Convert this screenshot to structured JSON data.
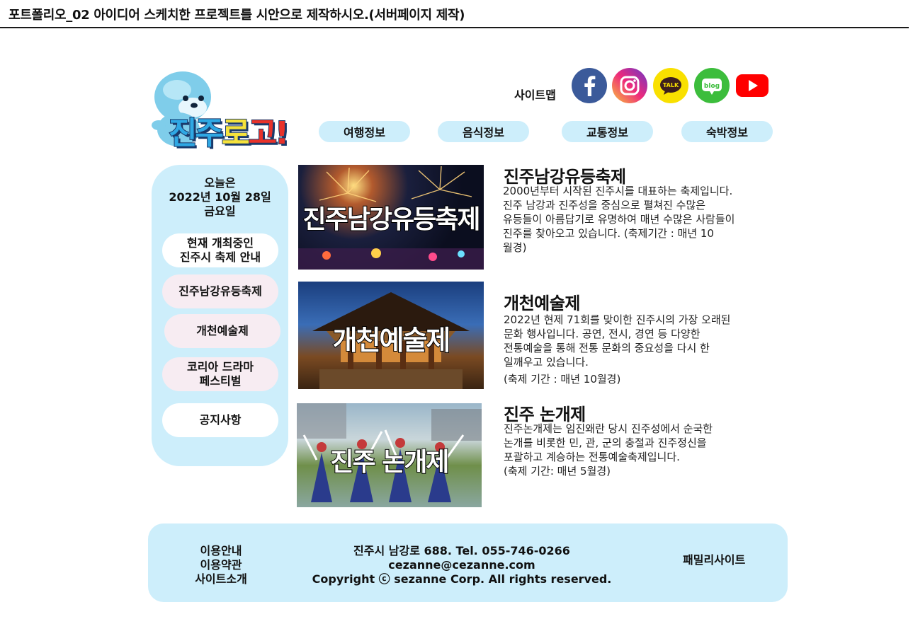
{
  "header": {
    "title": "포트폴리오_02 아이디어 스케치한 프로젝트를 시안으로 제작하시오.(서버페이지 제작)"
  },
  "logo": {
    "char1": "진",
    "char2": "주",
    "char3": "로",
    "char4": "고",
    "char5": "!"
  },
  "utility": {
    "sitemap": "사이트맵",
    "kakao_label": "TALK",
    "blog_label": "blog"
  },
  "nav": [
    "여행정보",
    "음식정보",
    "교통정보",
    "숙박정보"
  ],
  "sidebar": {
    "date_line1": "오늘은",
    "date_line2": "2022년 10월 28일",
    "date_line3": "금요일",
    "items": [
      {
        "line1": "현재 개최중인",
        "line2": "진주시 축제 안내"
      },
      {
        "line1": "진주남강유등축제",
        "line2": ""
      },
      {
        "line1": "개천예술제",
        "line2": ""
      },
      {
        "line1": "코리아 드라마",
        "line2": "페스티벌"
      },
      {
        "line1": "공지사항",
        "line2": ""
      }
    ]
  },
  "festivals": [
    {
      "image_caption": "진주남강유등축제",
      "title": "진주남강유등축제",
      "desc": "2000년부터 시작된 진주시를 대표하는 축제입니다.\n진주 남강과 진주성을 중심으로 펼쳐진 수많은\n유등들이 아름답기로 유명하여 매년 수많은 사람들이\n진주를 찾아오고 있습니다. (축제기간 : 매년 10\n월경)"
    },
    {
      "image_caption": "개천예술제",
      "title": "개천예술제",
      "desc": "2022년 현제 71회를 맞이한 진주시의 가장 오래된\n문화 행사입니다. 공연, 전시, 경연 등 다양한\n전통예술을 통해 전통 문화의 중요성을 다시 한\n일깨우고 있습니다.",
      "period": "(축제 기간 : 매년 10월경)"
    },
    {
      "image_caption": "진주 논개제",
      "title": "진주 논개제",
      "desc": "진주논개제는 임진왜란 당시 진주성에서 순국한\n논개를 비롯한 민, 관, 군의 충절과 진주정신을\n포괄하고 계승하는 전통예술축제입니다.\n(축제 기간: 매년 5월경)"
    }
  ],
  "footer": {
    "links": [
      "이용안내",
      "이용약관",
      "사이트소개"
    ],
    "address": "진주시 남강로 688. Tel. 055-746-0266",
    "email": "cezanne@cezanne.com",
    "copyright": "Copyright ⓒ sezanne Corp. All rights reserved.",
    "family": "패밀리사이트"
  },
  "colors": {
    "accent_light": "#cdeefb",
    "pink_button": "#f7ecf2",
    "white_button": "#ffffff"
  }
}
